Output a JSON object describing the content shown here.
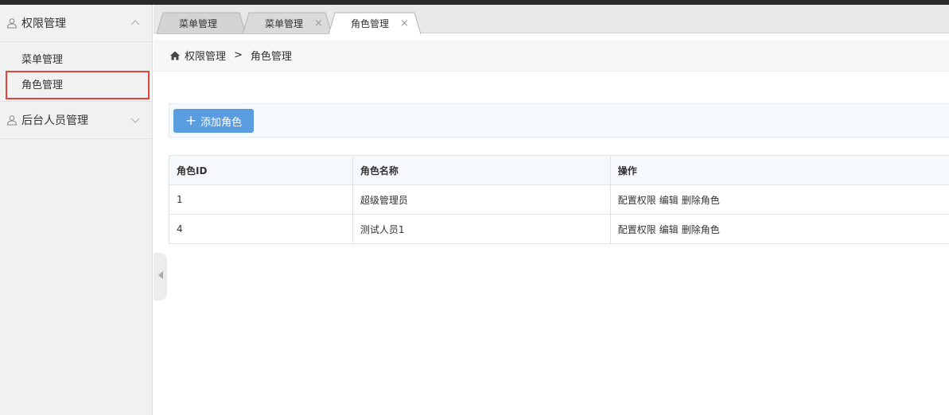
{
  "sidebar": {
    "groups": [
      {
        "label": "权限管理",
        "expanded": true,
        "items": [
          {
            "label": "菜单管理"
          },
          {
            "label": "角色管理",
            "active": true
          }
        ]
      },
      {
        "label": "后台人员管理",
        "expanded": false,
        "items": []
      }
    ]
  },
  "tabs": [
    {
      "label": "菜单管理",
      "closable": false
    },
    {
      "label": "菜单管理",
      "closable": true,
      "close_glyph": "×"
    },
    {
      "label": "角色管理",
      "closable": true,
      "close_glyph": "×",
      "active": true
    }
  ],
  "breadcrumb": {
    "items": [
      "权限管理",
      "角色管理"
    ],
    "separator": ">"
  },
  "toolbar": {
    "add_role_label": "添加角色",
    "add_glyph": "+"
  },
  "table": {
    "headers": [
      "角色ID",
      "角色名称",
      "操作"
    ],
    "rows": [
      {
        "id": "1",
        "name": "超级管理员",
        "actions": [
          "配置权限",
          "编辑",
          "删除角色"
        ]
      },
      {
        "id": "4",
        "name": "测试人员1",
        "actions": [
          "配置权限",
          "编辑",
          "删除角色"
        ]
      }
    ]
  },
  "colors": {
    "accent": "#5a9ce0",
    "highlight_border": "#e2443a",
    "sidebar_bg": "#f1f1f1"
  },
  "icons": {
    "group": "user-icon",
    "chevron_up": "chevron-up-icon",
    "chevron_down": "chevron-down-icon",
    "home": "home-icon",
    "collapse": "caret-left-icon"
  }
}
